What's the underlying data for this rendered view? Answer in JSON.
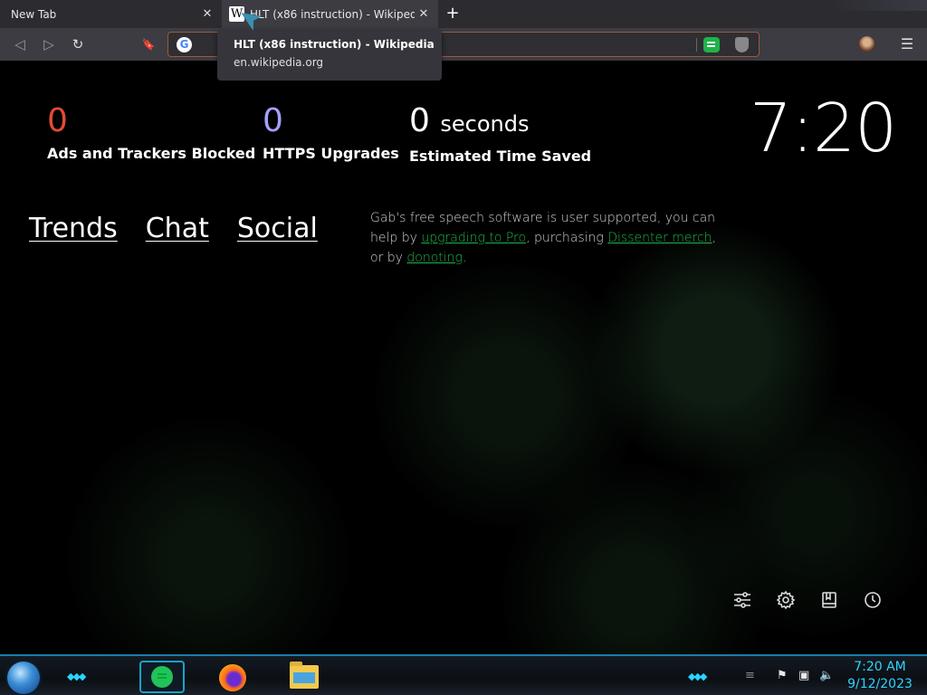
{
  "tabs": [
    {
      "title": "New Tab",
      "close": "✕"
    },
    {
      "title": "HLT (x86 instruction) - Wikipedia",
      "close": "✕",
      "favicon": "W"
    }
  ],
  "new_tab_symbol": "+",
  "toolbar": {
    "back_icon": "◁",
    "forward_icon": "▷",
    "reload_icon": "↻",
    "bookmark_icon": "🔖",
    "google_letter": "G",
    "menu_icon": "☰"
  },
  "tooltip": {
    "title": "HLT (x86 instruction) - Wikipedia",
    "url": "en.wikipedia.org"
  },
  "stats": {
    "ads": {
      "value": "0",
      "label": "Ads and Trackers Blocked",
      "color": "#e24b33"
    },
    "https": {
      "value": "0",
      "label": "HTTPS Upgrades",
      "color": "#a3a0ff"
    },
    "time": {
      "value": "0",
      "unit": "seconds",
      "label": "Estimated Time Saved",
      "color": "#ffffff"
    }
  },
  "clock": "7:20",
  "links": [
    "Trends",
    "Chat",
    "Social"
  ],
  "support": {
    "part1": "Gab's free speech software is user supported, you can help by ",
    "link1": "upgrading to Pro",
    "part2": ", purchasing ",
    "link2": "Dissenter merch",
    "part3": ", or by ",
    "link3": "donoting",
    "part4": "."
  },
  "bottom_icons": [
    "sliders-icon",
    "gear-icon",
    "bookmark-book-icon",
    "history-icon"
  ],
  "taskbar": {
    "time": "7:20 AM",
    "date": "9/12/2023",
    "accent": "#1a7ea8"
  }
}
